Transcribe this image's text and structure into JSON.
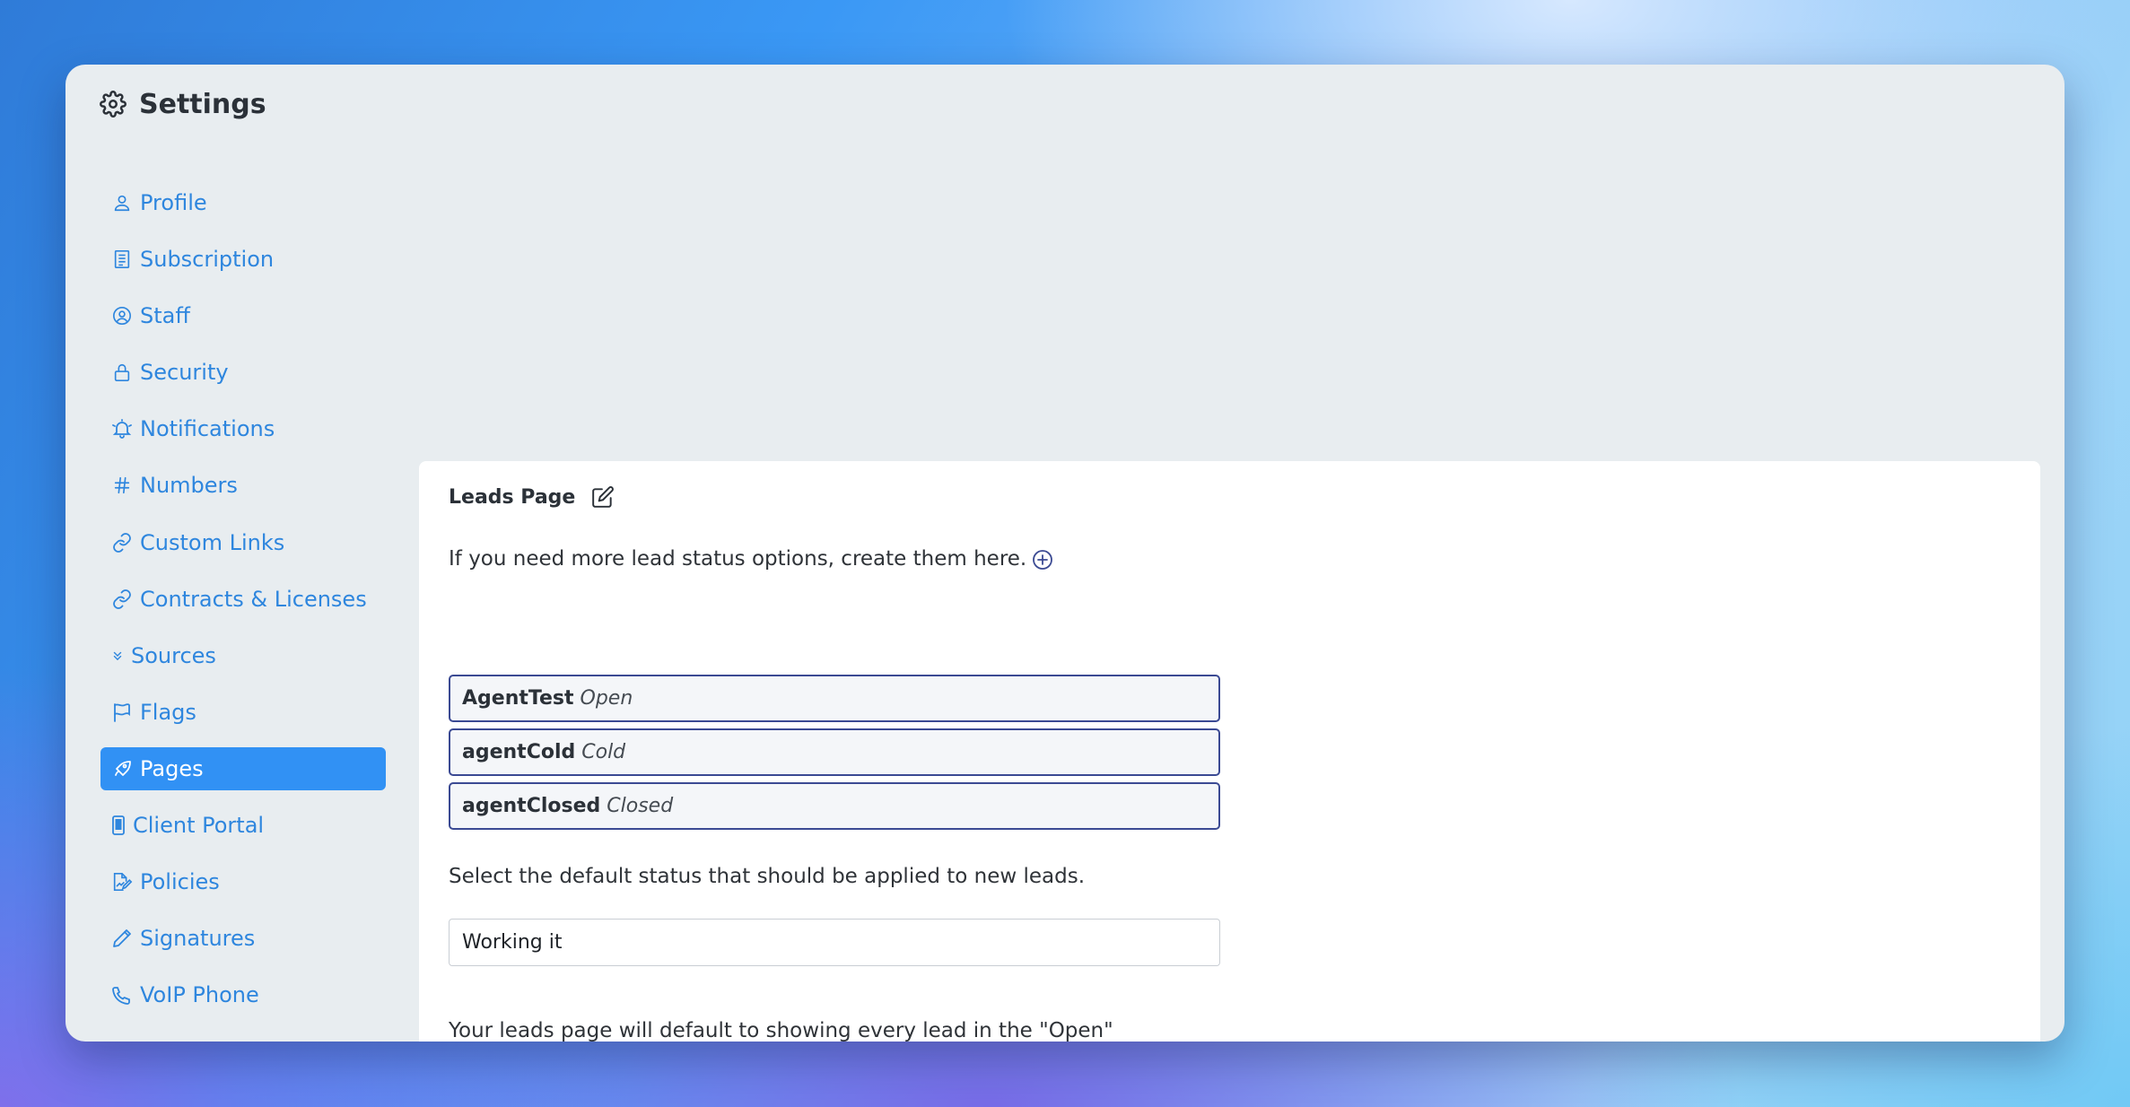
{
  "window": {
    "title": "Settings"
  },
  "sidebar": {
    "items": [
      {
        "label": "Profile",
        "icon": "user-icon"
      },
      {
        "label": "Subscription",
        "icon": "receipt-icon"
      },
      {
        "label": "Staff",
        "icon": "user-circle-icon"
      },
      {
        "label": "Security",
        "icon": "lock-icon"
      },
      {
        "label": "Notifications",
        "icon": "bell-icon"
      },
      {
        "label": "Numbers",
        "icon": "hash-icon"
      },
      {
        "label": "Custom Links",
        "icon": "link-icon"
      },
      {
        "label": "Contracts & Licenses",
        "icon": "link-icon"
      },
      {
        "label": "Sources",
        "icon": "chevrons-down-icon"
      },
      {
        "label": "Flags",
        "icon": "flag-icon"
      },
      {
        "label": "Pages",
        "icon": "rocket-icon",
        "active": true
      },
      {
        "label": "Client Portal",
        "icon": "phone-device-icon"
      },
      {
        "label": "Policies",
        "icon": "file-edit-icon"
      },
      {
        "label": "Signatures",
        "icon": "pencil-icon"
      },
      {
        "label": "VoIP Phone",
        "icon": "phone-icon"
      }
    ]
  },
  "panel": {
    "title": "Leads Page",
    "add_text": "If you need more lead status options, create them here.",
    "statuses": [
      {
        "name": "AgentTest",
        "kind": "Open"
      },
      {
        "name": "agentCold",
        "kind": "Cold"
      },
      {
        "name": "agentClosed",
        "kind": "Closed"
      }
    ],
    "default_prompt": "Select the default status that should be applied to new leads.",
    "default_value": "Working it",
    "filter_text": "Your leads page will default to showing every lead in the \"Open\" disposition on first load. If you prefer to see leads only by a particular status, then select that below."
  },
  "colors": {
    "accent": "#3191f4",
    "link": "#2e86de",
    "status_border": "#3b4a93"
  }
}
